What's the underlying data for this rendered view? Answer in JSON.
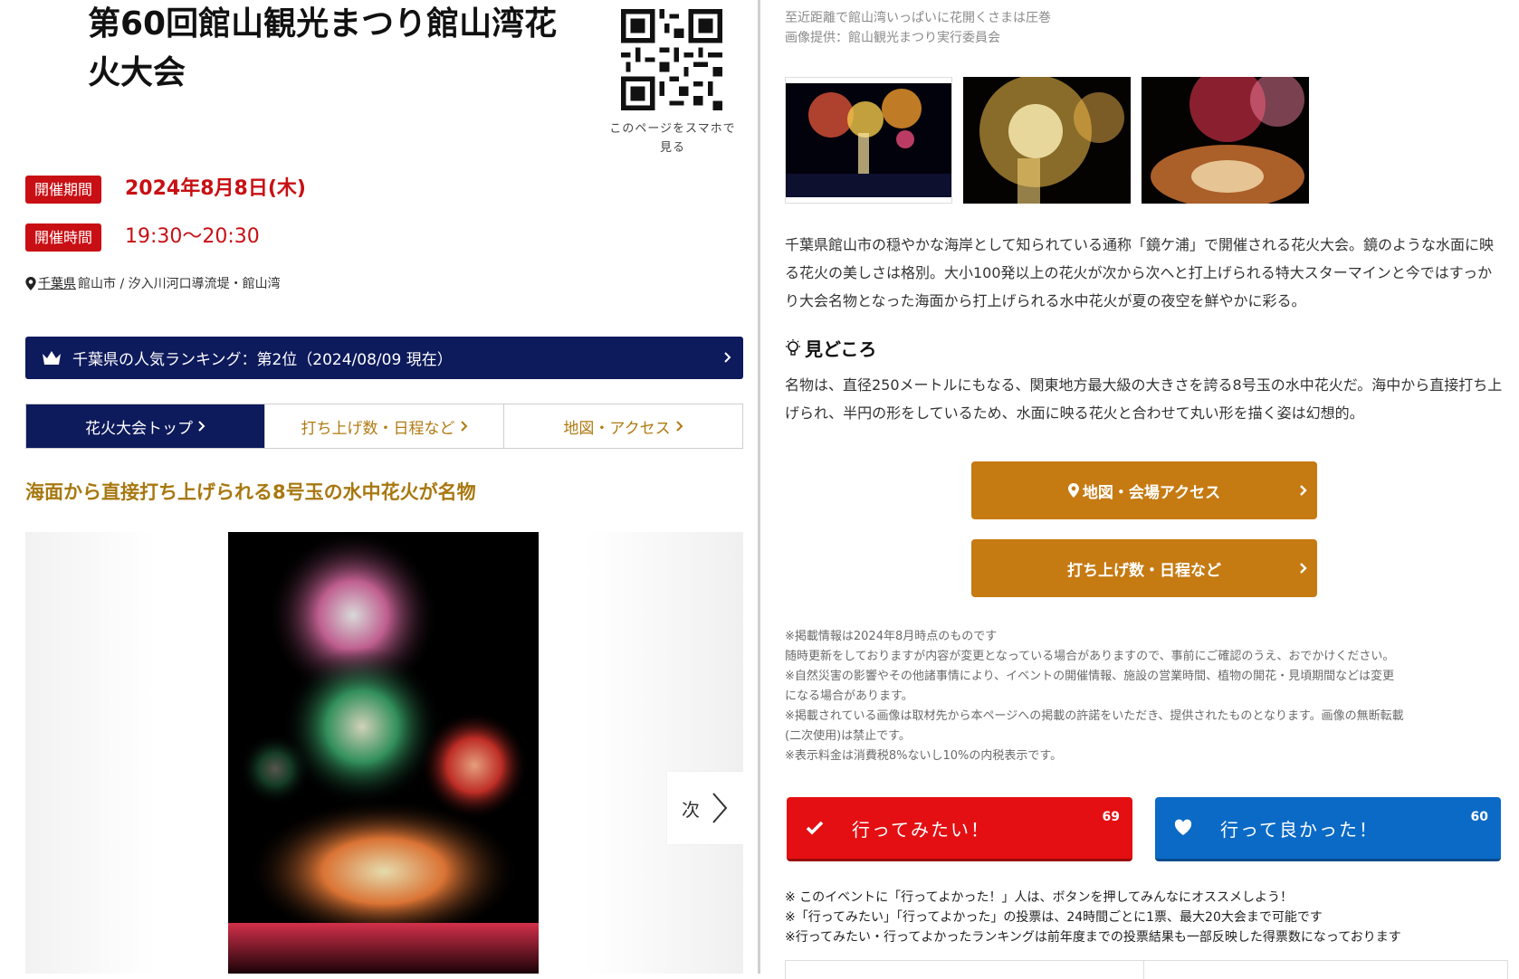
{
  "event": {
    "title_line1": "第60回館山観光まつり館山湾花",
    "title_line2": "火大会",
    "qr_caption_line1": "このページをスマホで",
    "qr_caption_line2": "見る",
    "period_label": "開催期間",
    "period_value": "2024年8月8日(木)",
    "time_label": "開催時間",
    "time_value": "19:30～20:30",
    "location_pref": "千葉県",
    "location_rest": "館山市 / 汐入川河口導流堤・館山湾"
  },
  "ranking": {
    "text": "千葉県の人気ランキング：第2位（2024/08/09 現在）"
  },
  "tabs": [
    {
      "label": "花火大会トップ",
      "active": true
    },
    {
      "label": "打ち上げ数・日程など",
      "active": false
    },
    {
      "label": "地図・アクセス",
      "active": false
    }
  ],
  "gallery": {
    "heading": "海面から直接打ち上げられる8号玉の水中花火が名物",
    "next_label": "次"
  },
  "photo_caption": {
    "line1": "至近距離で館山湾いっぱいに花開くさまは圧巻",
    "line2": "画像提供：館山観光まつり実行委員会"
  },
  "description": "千葉県館山市の穏やかな海岸として知られている通称「鏡ケ浦」で開催される花火大会。鏡のような水面に映る花火の美しさは格別。大小100発以上の花火が次から次へと打上げられる特大スターマインと今ではすっかり大会名物となった海面から打上げられる水中花火が夏の夜空を鮮やかに彩る。",
  "highlights": {
    "heading": "見どころ",
    "text": "名物は、直径250メートルにもなる、関東地方最大級の大きさを誇る8号玉の水中花火だ。海中から直接打ち上げられ、半円の形をしているため、水面に映る花火と合わせて丸い形を描く姿は幻想的。"
  },
  "buttons": {
    "map_access": "地図・会場アクセス",
    "schedule": "打ち上げ数・日程など"
  },
  "notes": [
    "※掲載情報は2024年8月時点のものです",
    "随時更新をしておりますが内容が変更となっている場合がありますので、事前にご確認のうえ、おでかけください。",
    "※自然災害の影響やその他諸事情により、イベントの開催情報、施設の営業時間、植物の開花・見頃期間などは変更",
    "になる場合があります。",
    "※掲載されている画像は取材先から本ページへの掲載の許諾をいただき、提供されたものとなります。画像の無断転載",
    "(二次使用)は禁止です。",
    "※表示料金は消費税8%ないし10%の内税表示です。"
  ],
  "votes": {
    "want": {
      "label": "行ってみたい！",
      "count": "69"
    },
    "good": {
      "label": "行って良かった！",
      "count": "60"
    }
  },
  "bottom_notes": [
    "※ このイベントに「行ってよかった！」人は、ボタンを押してみんなにオススメしよう！",
    "※「行ってみたい」「行ってよかった」の投票は、24時間ごとに1票、最大20大会まで可能です",
    "※行ってみたい・行ってよかったランキングは前年度までの投票結果も一部反映した得票数になっております"
  ],
  "colors": {
    "navy": "#0d1a5c",
    "red": "#c80f14",
    "gold": "#c67a12",
    "heading_gold": "#a87810",
    "vote_red": "#e40f12",
    "vote_blue": "#0b6ac6"
  },
  "icons": [
    "qr-code",
    "location-pin-icon",
    "crown-icon",
    "chevron-right-icon",
    "lightbulb-icon",
    "check-icon",
    "heart-icon"
  ]
}
